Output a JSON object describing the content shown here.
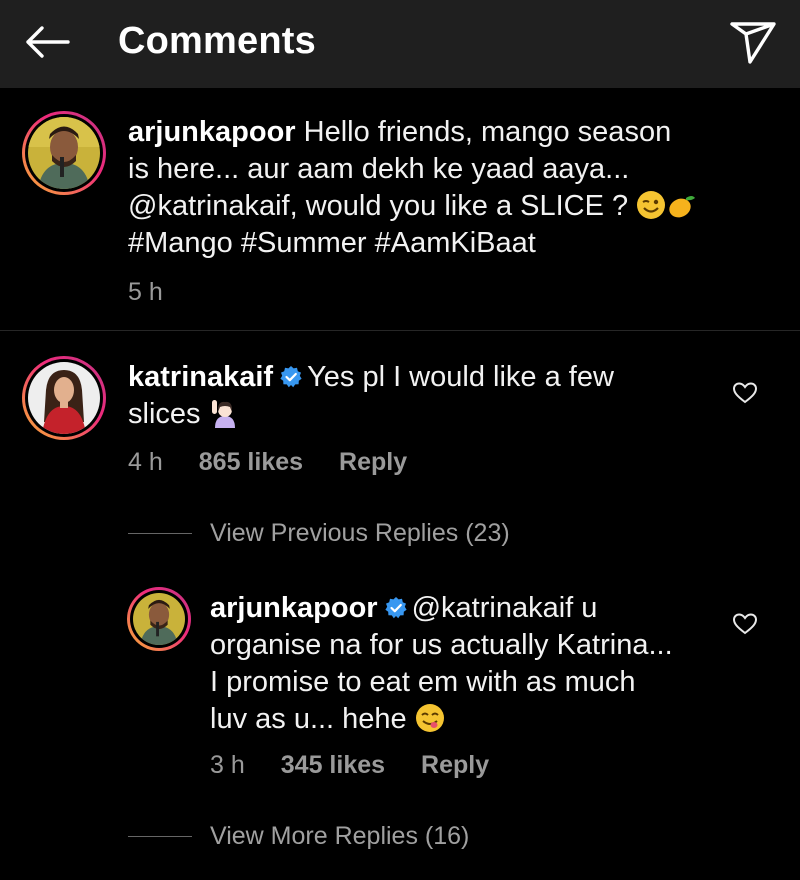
{
  "header": {
    "title": "Comments",
    "back_icon": "arrow-left-icon",
    "share_icon": "paper-plane-icon"
  },
  "caption": {
    "username": "arjunkapoor",
    "line1": "Hello friends, mango season",
    "line2": "is here... aur aam dekh ke yaad aaya...",
    "line3": "@katrinakaif, would you like a SLICE ?",
    "line4": "#Mango #Summer #AamKiBaat",
    "emojis": [
      "winking-face",
      "mango"
    ],
    "time": "5 h"
  },
  "comment": {
    "username": "katrinakaif",
    "verified": true,
    "line1": "Yes pl I would like a few",
    "line2": "slices",
    "emoji": "person-raising-hand",
    "time": "4 h",
    "likes": "865 likes",
    "reply": "Reply"
  },
  "view_previous": "View Previous Replies (23)",
  "reply": {
    "username": "arjunkapoor",
    "verified": true,
    "line1": "@katrinakaif u",
    "line2": "organise na for us actually Katrina...",
    "line3": "I promise to eat em with as much",
    "line4": "luv as u... hehe",
    "emoji": "face-savoring-food",
    "time": "3 h",
    "likes": "345 likes",
    "reply": "Reply"
  },
  "view_more": "View More Replies (16)",
  "colors": {
    "header_bg": "#1f1f1f",
    "background": "#000000",
    "verified": "#3897f0",
    "muted_text": "#9a9a9a",
    "story_ring": [
      "#f9b233",
      "#ee2a7b",
      "#c13584"
    ]
  }
}
